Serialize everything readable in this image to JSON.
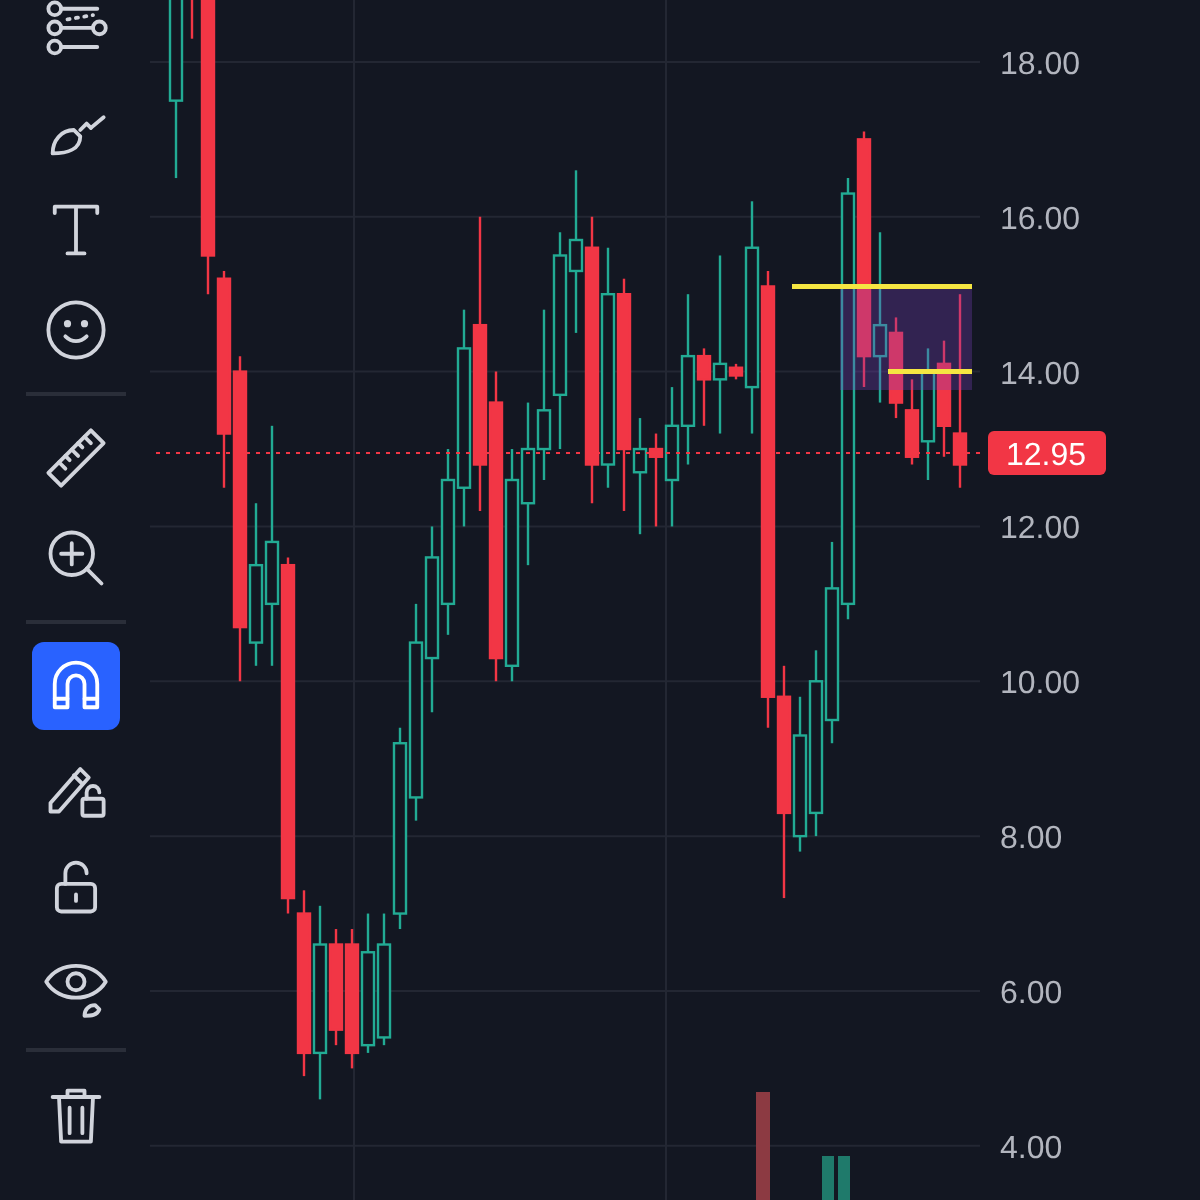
{
  "toolbar": [
    {
      "kind": "lines",
      "selected": false
    },
    {
      "kind": "brush",
      "selected": false
    },
    {
      "kind": "text",
      "selected": false
    },
    {
      "kind": "emoji",
      "selected": false
    },
    {
      "kind": "divider"
    },
    {
      "kind": "ruler",
      "selected": false
    },
    {
      "kind": "zoom",
      "selected": false
    },
    {
      "kind": "divider"
    },
    {
      "kind": "magnet",
      "selected": true
    },
    {
      "kind": "pencil-lock",
      "selected": false
    },
    {
      "kind": "lock",
      "selected": false
    },
    {
      "kind": "eye",
      "selected": false
    },
    {
      "kind": "divider"
    },
    {
      "kind": "trash",
      "selected": false
    }
  ],
  "chart_data": {
    "type": "candlestick",
    "ylim": [
      3.3,
      18.8
    ],
    "grid": true,
    "yticks": [
      {
        "value": 18,
        "label": "18.00"
      },
      {
        "value": 16,
        "label": "16.00"
      },
      {
        "value": 14,
        "label": "14.00"
      },
      {
        "value": 12,
        "label": "12.00"
      },
      {
        "value": 10,
        "label": "10.00"
      },
      {
        "value": 8,
        "label": "8.00"
      },
      {
        "value": 6,
        "label": "6.00"
      },
      {
        "value": 4,
        "label": "4.00"
      }
    ],
    "ohlc": [
      [
        17.5,
        19.5,
        16.5,
        19
      ],
      [
        19.5,
        19.6,
        18.3,
        18.9
      ],
      [
        19,
        19.5,
        15,
        15.5
      ],
      [
        15.2,
        15.3,
        12.5,
        13.2
      ],
      [
        14,
        14.2,
        10,
        10.7
      ],
      [
        10.5,
        12.3,
        10.2,
        11.5
      ],
      [
        11,
        13.3,
        10.2,
        11.8
      ],
      [
        11.5,
        11.6,
        7,
        7.2
      ],
      [
        7,
        7.3,
        4.9,
        5.2
      ],
      [
        5.2,
        7.1,
        4.6,
        6.6
      ],
      [
        6.6,
        6.8,
        5.3,
        5.5
      ],
      [
        6.6,
        6.8,
        5,
        5.2
      ],
      [
        5.3,
        7,
        5.2,
        6.5
      ],
      [
        5.4,
        7,
        5.3,
        6.6
      ],
      [
        7,
        9.4,
        6.8,
        9.2
      ],
      [
        8.5,
        11,
        8.2,
        10.5
      ],
      [
        10.3,
        12,
        9.6,
        11.6
      ],
      [
        11,
        13,
        10.6,
        12.6
      ],
      [
        12.5,
        14.8,
        12,
        14.3
      ],
      [
        14.6,
        16,
        12.2,
        12.8
      ],
      [
        13.6,
        14,
        10,
        10.3
      ],
      [
        10.2,
        13,
        10,
        12.6
      ],
      [
        12.3,
        13.6,
        11.5,
        13
      ],
      [
        13,
        14.8,
        12.6,
        13.5
      ],
      [
        13.7,
        15.8,
        13,
        15.5
      ],
      [
        15.3,
        16.6,
        14.5,
        15.7
      ],
      [
        15.6,
        16,
        12.3,
        12.8
      ],
      [
        12.8,
        15.6,
        12.5,
        15
      ],
      [
        15,
        15.2,
        12.2,
        13
      ],
      [
        12.7,
        13.4,
        11.9,
        13
      ],
      [
        13,
        13.2,
        12,
        12.9
      ],
      [
        12.6,
        13.8,
        12,
        13.3
      ],
      [
        13.3,
        15,
        12.8,
        14.2
      ],
      [
        14.2,
        14.3,
        13.3,
        13.9
      ],
      [
        13.9,
        15.5,
        13.2,
        14.1
      ],
      [
        14.05,
        14.1,
        13.9,
        13.95
      ],
      [
        13.8,
        16.2,
        13.2,
        15.6
      ],
      [
        15.1,
        15.3,
        9.4,
        9.8
      ],
      [
        9.8,
        10.2,
        7.2,
        8.3
      ],
      [
        8,
        9.8,
        7.8,
        9.3
      ],
      [
        8.3,
        10.4,
        8,
        10
      ],
      [
        9.5,
        11.8,
        9.2,
        11.2
      ],
      [
        11,
        16.5,
        10.8,
        16.3
      ],
      [
        17,
        17.1,
        13.8,
        14.2
      ],
      [
        14.2,
        15.8,
        13.6,
        14.6
      ],
      [
        14.5,
        14.7,
        13.4,
        13.6
      ],
      [
        13.5,
        13.9,
        12.8,
        12.9
      ],
      [
        13.1,
        14.3,
        12.6,
        14
      ],
      [
        14.1,
        14.4,
        12.9,
        13.3
      ],
      [
        13.2,
        15,
        12.5,
        12.8
      ]
    ]
  },
  "last_price": "12.95"
}
